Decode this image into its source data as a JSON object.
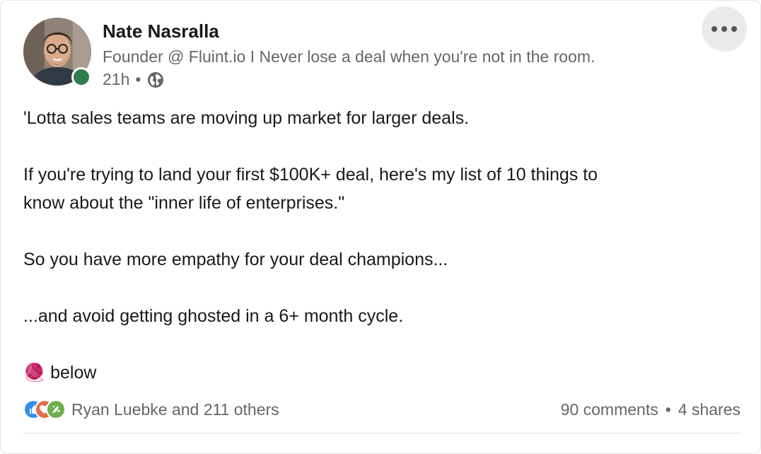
{
  "author": {
    "name": "Nate Nasralla",
    "headline": "Founder @ Fluint.io I Never lose a deal when you're not in the room.",
    "time": "21h",
    "separator": "•",
    "online_color": "#2e7d4a"
  },
  "post": {
    "line1": "'Lotta sales teams are moving up market for larger deals.",
    "line2": "If you're trying to land your first $100K+ deal, here's my list of 10 things to",
    "line3": "know about the \"inner life of enterprises.\"",
    "line4": "So you have more empathy for your deal champions...",
    "line5": "...and avoid getting ghosted in a 6+ month cycle.",
    "line6_emoji": "🧶",
    "line6_text": "below"
  },
  "social": {
    "reaction_icons": [
      "like-icon",
      "love-icon",
      "celebrate-icon"
    ],
    "reactors": "Ryan Luebke and 211 others",
    "comments": "90 comments",
    "dot": "•",
    "shares": "4 shares"
  },
  "colors": {
    "like": "#378fe9",
    "love": "#df704d",
    "celebrate": "#6dae4f"
  }
}
